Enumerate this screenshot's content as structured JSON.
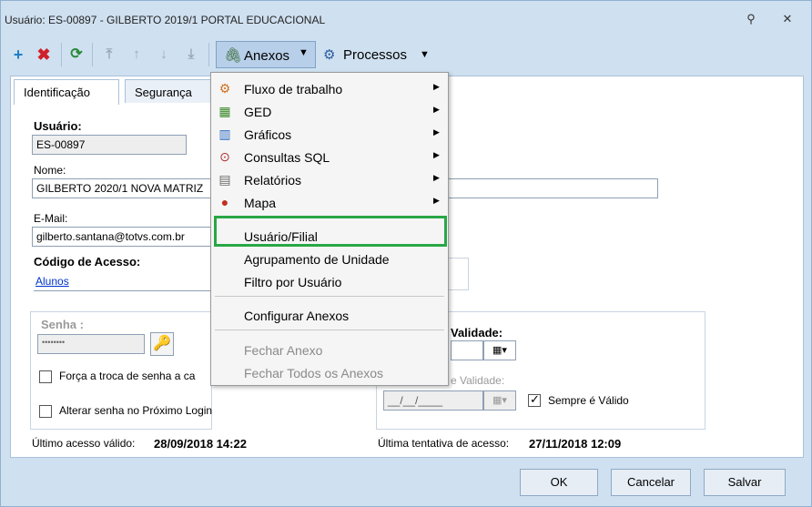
{
  "window": {
    "title": "Usuário: ES-00897 - GILBERTO 2019/1 PORTAL EDUCACIONAL"
  },
  "toolbar": {
    "anexos_label": "Anexos",
    "processos_label": "Processos"
  },
  "tabs": [
    {
      "label": "Identificação"
    },
    {
      "label": "Segurança"
    }
  ],
  "form": {
    "usuario_label": "Usuário:",
    "usuario_value": "ES-00897",
    "nome_label": "Nome:",
    "nome_value": "GILBERTO 2020/1 NOVA MATRIZ",
    "email_label": "E-Mail:",
    "email_value": "gilberto.santana@totvs.com.br",
    "codigo_label": "Código de Acesso:",
    "codigo_value": "Alunos",
    "senha_label": "Senha :",
    "senha_value": "••••••••",
    "forca_troca_label": "Força a troca de senha a ca",
    "alterar_senha_label": "Alterar senha no Próximo Login",
    "validade_label": "Validade:",
    "validade2_label": "e Validade:",
    "data_placeholder": "__/__/____",
    "sempre_valido_label": "Sempre é Válido",
    "ultimo_acesso_label": "Último acesso válido:",
    "ultimo_acesso_value": "28/09/2018 14:22",
    "ultima_tentativa_label": "Última tentativa de acesso:",
    "ultima_tentativa_value": "27/11/2018 12:09"
  },
  "menu": {
    "items": [
      {
        "label": "Fluxo de trabalho",
        "icon": "workflow-icon",
        "submenu": true
      },
      {
        "label": "GED",
        "icon": "ged-icon",
        "submenu": true
      },
      {
        "label": "Gráficos",
        "icon": "chart-icon",
        "submenu": true
      },
      {
        "label": "Consultas SQL",
        "icon": "sql-query-icon",
        "submenu": true
      },
      {
        "label": "Relatórios",
        "icon": "report-icon",
        "submenu": true
      },
      {
        "label": "Mapa",
        "icon": "map-pin-icon",
        "submenu": true
      },
      {
        "label": "Usuário/Filial"
      },
      {
        "label": "Agrupamento de Unidade"
      },
      {
        "label": "Filtro por Usuário"
      },
      {
        "label": "Configurar Anexos"
      },
      {
        "label": "Fechar Anexo",
        "disabled": true
      },
      {
        "label": "Fechar Todos os Anexos",
        "disabled": true
      }
    ]
  },
  "footer": {
    "ok_label": "OK",
    "cancelar_label": "Cancelar",
    "salvar_label": "Salvar"
  },
  "colors": {
    "highlight": "#28a745",
    "window_bg": "#cfe0f0"
  }
}
